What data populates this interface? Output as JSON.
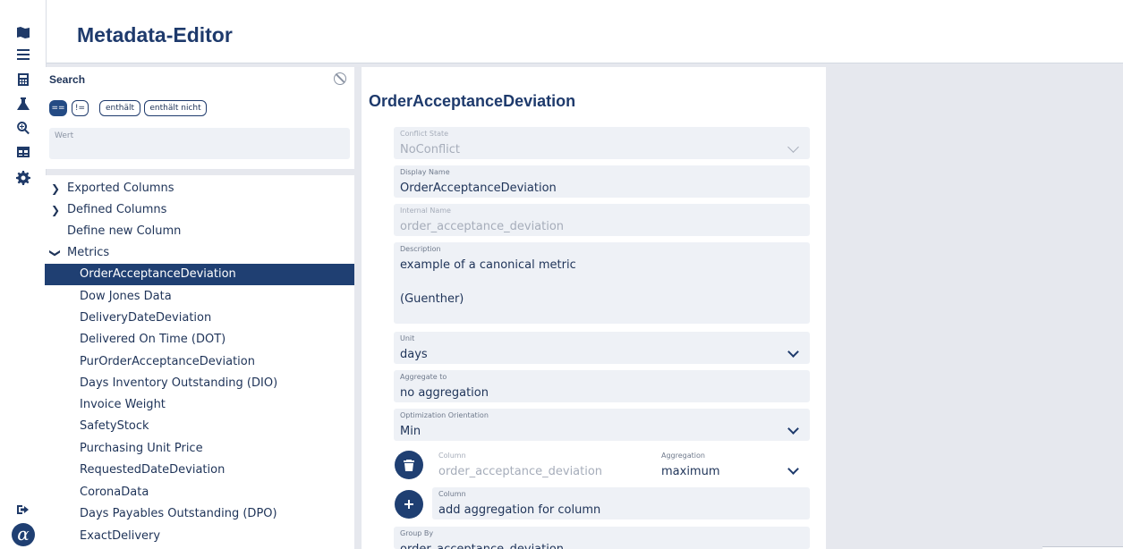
{
  "app": {
    "title": "Metadata-Editor"
  },
  "rail": {
    "icons": [
      "map-icon",
      "list-icon",
      "calculator-icon",
      "flask-icon",
      "zoom-icon",
      "table-icon",
      "gear-icon",
      "logout-icon",
      "alpha-logo"
    ]
  },
  "search": {
    "label": "Search",
    "operators": [
      "==",
      "!=",
      "enthält",
      "enthält nicht"
    ],
    "active_operator": "==",
    "value_label": "Wert",
    "value": ""
  },
  "tree": {
    "groups": [
      {
        "label": "Exported Columns",
        "expanded": false
      },
      {
        "label": "Defined Columns",
        "expanded": false
      },
      {
        "label": "Define new Column"
      },
      {
        "label": "Metrics",
        "expanded": true
      }
    ],
    "metrics": [
      "OrderAcceptanceDeviation",
      "Dow Jones Data",
      "DeliveryDateDeviation",
      "Delivered On Time (DOT)",
      "PurOrderAcceptanceDeviation",
      "Days Inventory Outstanding (DIO)",
      "Invoice Weight",
      "SafetyStock",
      "Purchasing Unit Price",
      "RequestedDateDeviation",
      "CoronaData",
      "Days Payables Outstanding (DPO)",
      "ExactDelivery"
    ],
    "selected": "OrderAcceptanceDeviation"
  },
  "form": {
    "heading": "OrderAcceptanceDeviation",
    "conflict_state": {
      "label": "Conflict State",
      "value": "NoConflict"
    },
    "display_name": {
      "label": "Display Name",
      "value": "OrderAcceptanceDeviation"
    },
    "internal_name": {
      "label": "Internal Name",
      "value": "order_acceptance_deviation"
    },
    "description": {
      "label": "Description",
      "value": "example of a canonical metric\n\n(Guenther)"
    },
    "unit": {
      "label": "Unit",
      "value": "days"
    },
    "aggregate_to": {
      "label": "Aggregate to",
      "value": "no aggregation"
    },
    "optimization": {
      "label": "Optimization Orientation",
      "value": "Min"
    },
    "agg_row": {
      "column_label": "Column",
      "column_value": "order_acceptance_deviation",
      "aggregation_label": "Aggregation",
      "aggregation_value": "maximum"
    },
    "add_row": {
      "column_label": "Column",
      "placeholder": "add aggregation for column"
    },
    "group_by": {
      "label": "Group By",
      "value": "order_acceptance_deviation"
    }
  },
  "colors": {
    "primary": "#1f3f72",
    "field_bg": "#eef1f6",
    "page_bg": "#e6e8ee"
  }
}
